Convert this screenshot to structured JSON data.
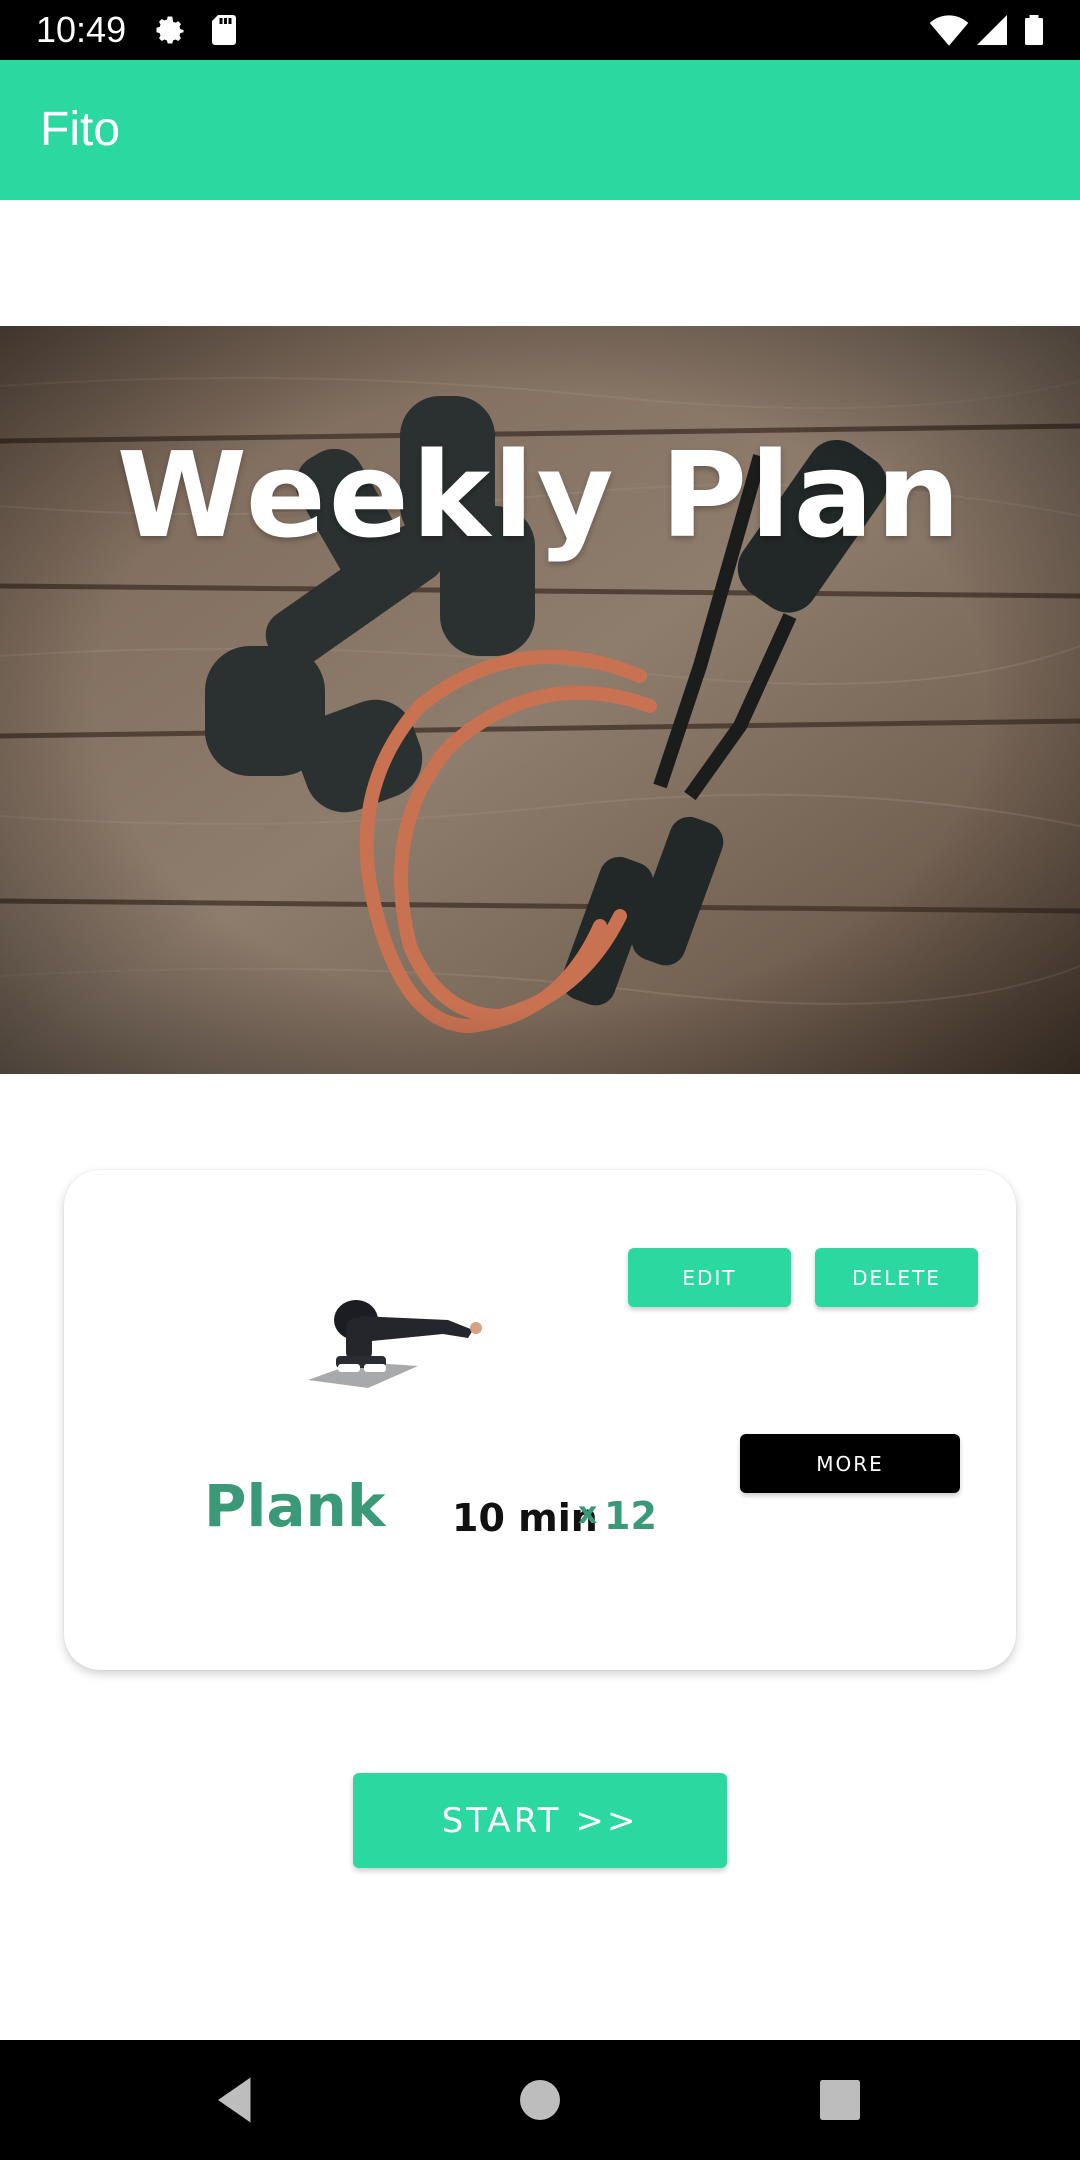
{
  "status_bar": {
    "time": "10:49",
    "icons": [
      "settings-icon",
      "sd-card-icon",
      "wifi-icon",
      "signal-icon",
      "battery-icon"
    ]
  },
  "app_bar": {
    "title": "Fito",
    "color": "#2bd8a0"
  },
  "hero": {
    "title": "Weekly Plan",
    "image": "dumbbells-and-resistance-band-on-wood"
  },
  "exercise_card": {
    "image": "plank-exercise-figure",
    "name": "Plank",
    "duration": "10 min",
    "times_sign": "x",
    "reps": "12",
    "edit_label": "EDIT",
    "delete_label": "DELETE",
    "more_label": "MORE"
  },
  "start_label": "START >>",
  "colors": {
    "accent": "#2bd8a0",
    "exercise_text": "#3a9a78"
  },
  "nav_bar": {
    "icons": [
      "back-icon",
      "home-icon",
      "recents-icon"
    ]
  }
}
